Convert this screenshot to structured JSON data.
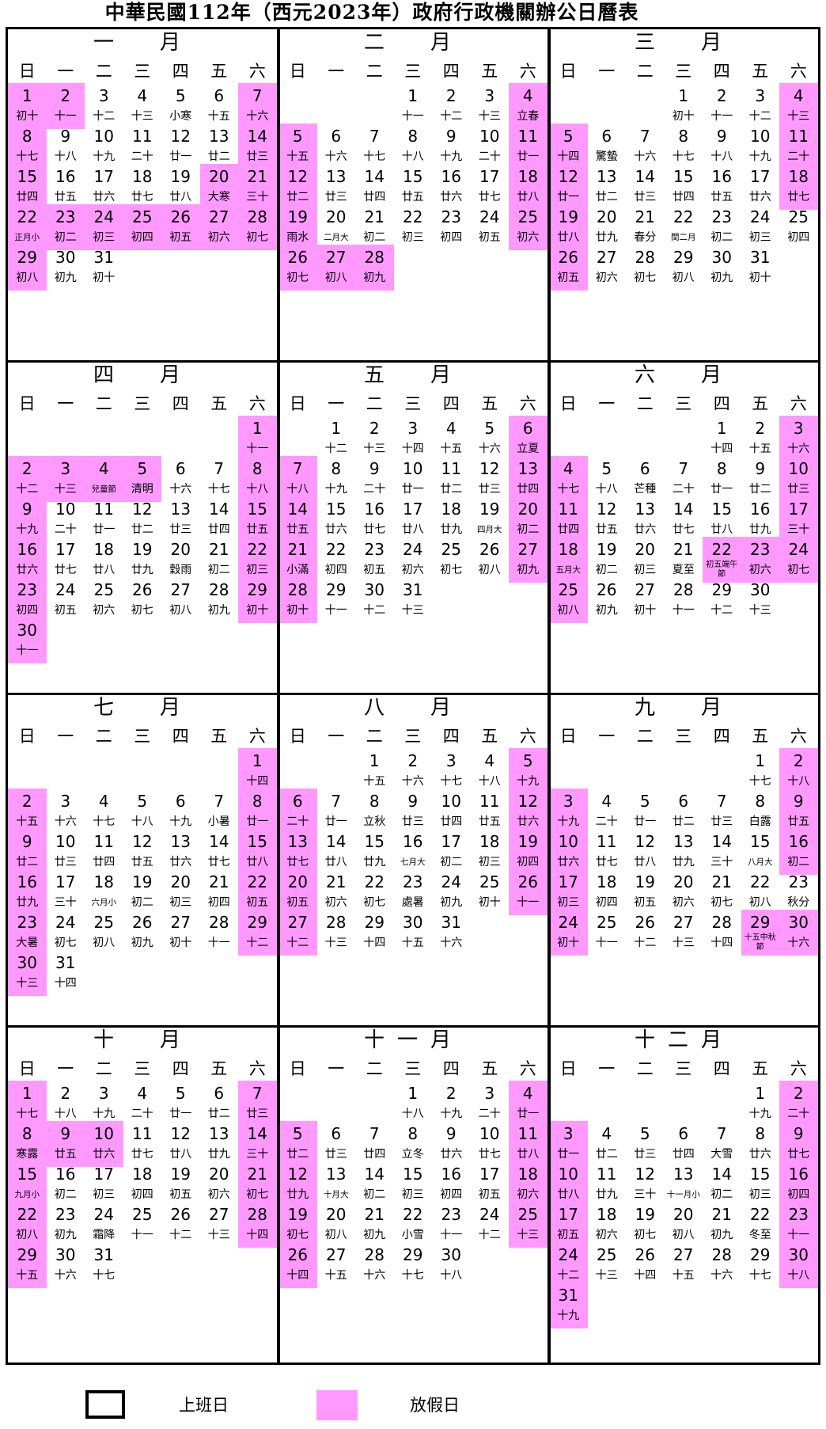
{
  "title": "中華民國112年（西元2023年）政府行政機關辦公日曆表",
  "weekday_labels": [
    "日",
    "一",
    "二",
    "三",
    "四",
    "五",
    "六"
  ],
  "months": [
    {
      "name": [
        "一",
        "月"
      ],
      "start": 0,
      "days": 31,
      "lunar": [
        "初十",
        "十一",
        "十二",
        "十三",
        "小寒",
        "十五",
        "十六",
        "十七",
        "十八",
        "十九",
        "二十",
        "廿一",
        "廿二",
        "廿三",
        "廿四",
        "廿五",
        "廿六",
        "廿七",
        "廿八",
        "大寒",
        "三十",
        "正月小",
        "初二",
        "初三",
        "初四",
        "初五",
        "初六",
        "初七",
        "初八",
        "初九",
        "初十"
      ],
      "holidays": [
        1,
        2,
        7,
        8,
        14,
        15,
        20,
        21,
        22,
        23,
        24,
        25,
        26,
        27,
        28,
        29
      ]
    },
    {
      "name": [
        "二",
        "月"
      ],
      "start": 3,
      "days": 28,
      "lunar": [
        "十一",
        "十二",
        "十三",
        "立春",
        "十五",
        "十六",
        "十七",
        "十八",
        "十九",
        "二十",
        "廿一",
        "廿二",
        "廿三",
        "廿四",
        "廿五",
        "廿六",
        "廿七",
        "廿八",
        "雨水",
        "二月大",
        "初二",
        "初三",
        "初四",
        "初五",
        "初六",
        "初七",
        "初八",
        "初九"
      ],
      "holidays": [
        4,
        5,
        11,
        12,
        18,
        19,
        25,
        26,
        27,
        28
      ]
    },
    {
      "name": [
        "三",
        "月"
      ],
      "start": 3,
      "days": 31,
      "lunar": [
        "初十",
        "十一",
        "十二",
        "十三",
        "十四",
        "驚蟄",
        "十六",
        "十七",
        "十八",
        "十九",
        "二十",
        "廿一",
        "廿二",
        "廿三",
        "廿四",
        "廿五",
        "廿六",
        "廿七",
        "廿八",
        "廿九",
        "春分",
        "閏二月",
        "初二",
        "初三",
        "初四",
        "初五",
        "初六",
        "初七",
        "初八",
        "初九",
        "初十"
      ],
      "holidays": [
        4,
        5,
        11,
        12,
        18,
        19,
        26
      ]
    },
    {
      "name": [
        "四",
        "月"
      ],
      "start": 6,
      "days": 30,
      "lunar": [
        "十一",
        "十二",
        "十三",
        "兒童節",
        "清明",
        "十六",
        "十七",
        "十八",
        "十九",
        "二十",
        "廿一",
        "廿二",
        "廿三",
        "廿四",
        "廿五",
        "廿六",
        "廿七",
        "廿八",
        "廿九",
        "穀雨",
        "初二",
        "初三",
        "初四",
        "初五",
        "初六",
        "初七",
        "初八",
        "初九",
        "初十",
        "十一"
      ],
      "holidays": [
        1,
        2,
        3,
        4,
        5,
        8,
        9,
        15,
        16,
        22,
        23,
        29,
        30
      ]
    },
    {
      "name": [
        "五",
        "月"
      ],
      "start": 1,
      "days": 31,
      "lunar": [
        "十二",
        "十三",
        "十四",
        "十五",
        "十六",
        "立夏",
        "十八",
        "十九",
        "二十",
        "廿一",
        "廿二",
        "廿三",
        "廿四",
        "廿五",
        "廿六",
        "廿七",
        "廿八",
        "廿九",
        "四月大",
        "初二",
        "小滿",
        "初四",
        "初五",
        "初六",
        "初七",
        "初八",
        "初九",
        "初十",
        "十一",
        "十二",
        "十三"
      ],
      "holidays": [
        6,
        7,
        13,
        14,
        20,
        21,
        27,
        28
      ]
    },
    {
      "name": [
        "六",
        "月"
      ],
      "start": 4,
      "days": 30,
      "lunar": [
        "十四",
        "十五",
        "十六",
        "十七",
        "十八",
        "芒種",
        "二十",
        "廿一",
        "廿二",
        "廿三",
        "廿四",
        "廿五",
        "廿六",
        "廿七",
        "廿八",
        "廿九",
        "三十",
        "五月大",
        "初二",
        "初三",
        "夏至",
        "初五端午節",
        "初六",
        "初七",
        "初八",
        "初九",
        "初十",
        "十一",
        "十二",
        "十三"
      ],
      "holidays": [
        3,
        4,
        10,
        11,
        17,
        18,
        22,
        23,
        24,
        25
      ]
    },
    {
      "name": [
        "七",
        "月"
      ],
      "start": 6,
      "days": 31,
      "lunar": [
        "十四",
        "十五",
        "十六",
        "十七",
        "十八",
        "十九",
        "小暑",
        "廿一",
        "廿二",
        "廿三",
        "廿四",
        "廿五",
        "廿六",
        "廿七",
        "廿八",
        "廿九",
        "三十",
        "六月小",
        "初二",
        "初三",
        "初四",
        "初五",
        "大暑",
        "初七",
        "初八",
        "初九",
        "初十",
        "十一",
        "十二",
        "十三",
        "十四"
      ],
      "holidays": [
        1,
        2,
        8,
        9,
        15,
        16,
        22,
        23,
        29,
        30
      ]
    },
    {
      "name": [
        "八",
        "月"
      ],
      "start": 2,
      "days": 31,
      "lunar": [
        "十五",
        "十六",
        "十七",
        "十八",
        "十九",
        "二十",
        "廿一",
        "立秋",
        "廿三",
        "廿四",
        "廿五",
        "廿六",
        "廿七",
        "廿八",
        "廿九",
        "七月大",
        "初二",
        "初三",
        "初四",
        "初五",
        "初六",
        "初七",
        "處暑",
        "初九",
        "初十",
        "十一",
        "十二",
        "十三",
        "十四",
        "十五",
        "十六"
      ],
      "holidays": [
        5,
        6,
        12,
        13,
        19,
        20,
        26,
        27
      ]
    },
    {
      "name": [
        "九",
        "月"
      ],
      "start": 5,
      "days": 30,
      "lunar": [
        "十七",
        "十八",
        "十九",
        "二十",
        "廿一",
        "廿二",
        "廿三",
        "白露",
        "廿五",
        "廿六",
        "廿七",
        "廿八",
        "廿九",
        "三十",
        "八月大",
        "初二",
        "初三",
        "初四",
        "初五",
        "初六",
        "初七",
        "初八",
        "秋分",
        "初十",
        "十一",
        "十二",
        "十三",
        "十四",
        "十五中秋節",
        "十六"
      ],
      "holidays": [
        2,
        3,
        9,
        10,
        16,
        17,
        24,
        29,
        30
      ]
    },
    {
      "name": [
        "十",
        "月"
      ],
      "start": 0,
      "days": 31,
      "lunar": [
        "十七",
        "十八",
        "十九",
        "二十",
        "廿一",
        "廿二",
        "廿三",
        "寒露",
        "廿五",
        "廿六",
        "廿七",
        "廿八",
        "廿九",
        "三十",
        "九月小",
        "初二",
        "初三",
        "初四",
        "初五",
        "初六",
        "初七",
        "初八",
        "初九",
        "霜降",
        "十一",
        "十二",
        "十三",
        "十四",
        "十五",
        "十六",
        "十七"
      ],
      "holidays": [
        1,
        7,
        8,
        9,
        10,
        14,
        15,
        21,
        22,
        28,
        29
      ]
    },
    {
      "name": [
        "十",
        "一",
        "月"
      ],
      "start": 3,
      "days": 30,
      "lunar": [
        "十八",
        "十九",
        "二十",
        "廿一",
        "廿二",
        "廿三",
        "廿四",
        "立冬",
        "廿六",
        "廿七",
        "廿八",
        "廿九",
        "十月大",
        "初二",
        "初三",
        "初四",
        "初五",
        "初六",
        "初七",
        "初八",
        "初九",
        "小雪",
        "十一",
        "十二",
        "十三",
        "十四",
        "十五",
        "十六",
        "十七",
        "十八"
      ],
      "holidays": [
        4,
        5,
        11,
        12,
        18,
        19,
        25,
        26
      ]
    },
    {
      "name": [
        "十",
        "二",
        "月"
      ],
      "start": 5,
      "days": 31,
      "lunar": [
        "十九",
        "二十",
        "廿一",
        "廿二",
        "廿三",
        "廿四",
        "大雪",
        "廿六",
        "廿七",
        "廿八",
        "廿九",
        "三十",
        "十一月小",
        "初二",
        "初三",
        "初四",
        "初五",
        "初六",
        "初七",
        "初八",
        "初九",
        "冬至",
        "十一",
        "十二",
        "十三",
        "十四",
        "十五",
        "十六",
        "十七",
        "十八",
        "十九"
      ],
      "holidays": [
        2,
        3,
        9,
        10,
        16,
        17,
        23,
        24,
        30,
        31
      ]
    }
  ],
  "legend": {
    "work_label": "上班日",
    "holiday_label": "放假日"
  },
  "colors": {
    "holiday": "#ff99ff",
    "border": "#000000"
  }
}
